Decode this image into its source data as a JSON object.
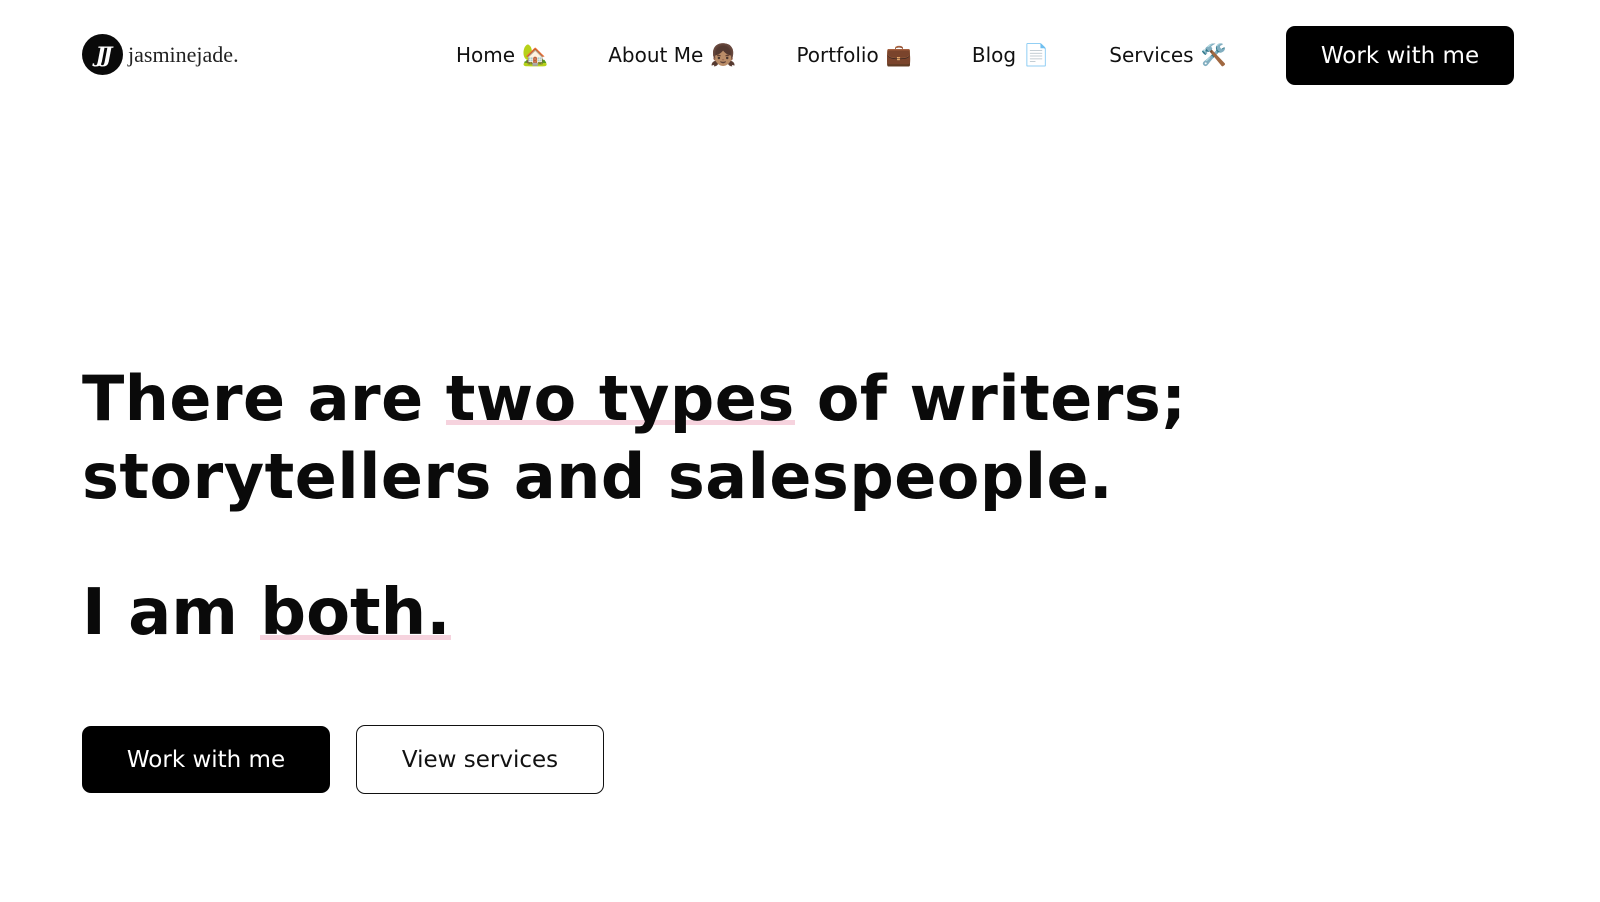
{
  "brand": {
    "logo_mark": "JJ",
    "name": "jasminejade."
  },
  "nav": {
    "items": [
      {
        "label": "Home",
        "emoji": "🏡"
      },
      {
        "label": "About Me",
        "emoji": "👧🏽"
      },
      {
        "label": "Portfolio",
        "emoji": "💼"
      },
      {
        "label": "Blog",
        "emoji": "📄"
      },
      {
        "label": "Services",
        "emoji": "🛠️"
      }
    ],
    "cta_label": "Work with me"
  },
  "hero": {
    "headline_part1": "There are ",
    "headline_highlight": "two types",
    "headline_part2": " of writers; storytellers and salespeople.",
    "subline_part1": "I am ",
    "subline_highlight": "both.",
    "primary_button": "Work with me",
    "secondary_button": "View services"
  },
  "colors": {
    "primary": "#000000",
    "background": "#ffffff",
    "highlight_underline": "#f6d3de"
  }
}
